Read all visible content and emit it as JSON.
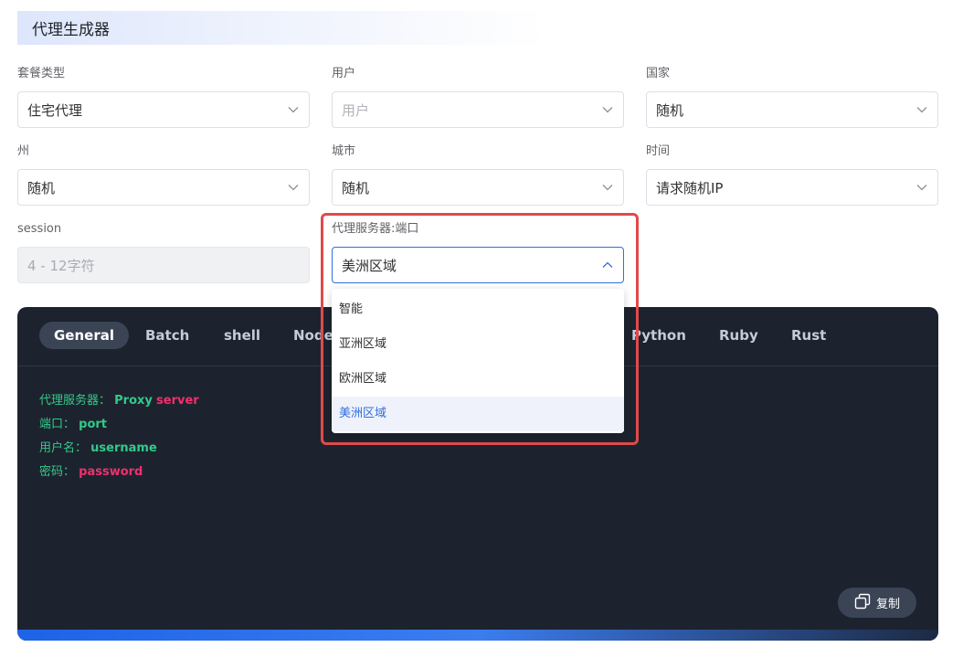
{
  "page": {
    "title": "代理生成器"
  },
  "fields": {
    "package": {
      "label": "套餐类型",
      "value": "住宅代理"
    },
    "user": {
      "label": "用户",
      "placeholder": "用户"
    },
    "country": {
      "label": "国家",
      "value": "随机"
    },
    "state": {
      "label": "州",
      "value": "随机"
    },
    "city": {
      "label": "城市",
      "value": "随机"
    },
    "time": {
      "label": "时间",
      "value": "请求随机IP"
    },
    "session": {
      "label": "session",
      "placeholder": "4 - 12字符"
    },
    "server": {
      "label": "代理服务器:端口",
      "value": "美洲区域",
      "options": [
        "智能",
        "亚洲区域",
        "欧洲区域",
        "美洲区域"
      ],
      "selected_index": 3
    }
  },
  "code": {
    "tabs": [
      "General",
      "Batch",
      "shell",
      "Node.",
      "Python",
      "Ruby",
      "Rust"
    ],
    "active_tab": "General",
    "lines": [
      {
        "key": "代理服务器：",
        "value1": "Proxy",
        "value2": "server"
      },
      {
        "key": "端口：",
        "value1": "port"
      },
      {
        "key": "用户名：",
        "value1": "username"
      },
      {
        "key": "密码：",
        "value1": "password"
      }
    ],
    "copy_label": "复制"
  },
  "colors": {
    "accent": "#2f6fe0",
    "highlight": "#e04a4a",
    "code_bg": "#1d232e",
    "code_green": "#33c98a",
    "code_pink": "#f0306e"
  },
  "icons": {
    "chevron": "chevron-down-icon",
    "chevron_open": "chevron-up-icon",
    "copy": "copy-icon"
  }
}
